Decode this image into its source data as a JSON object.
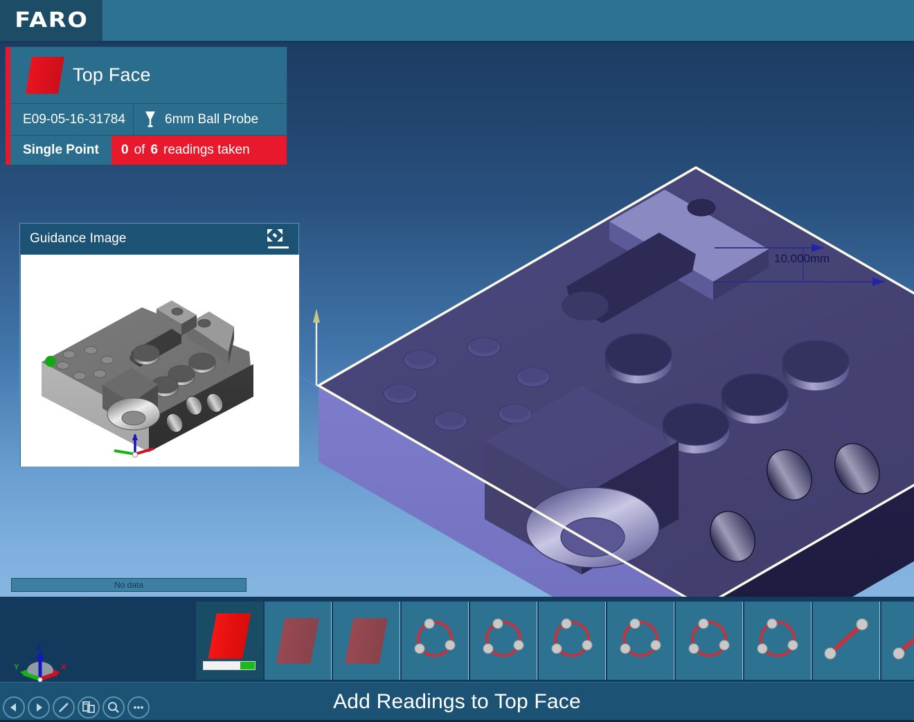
{
  "app": {
    "brand": "FARO",
    "accent_red": "#e8192c",
    "header_teal": "#2d7391",
    "panel_teal": "#2a6d8c"
  },
  "feature_panel": {
    "title": "Top Face",
    "swatch_icon": "plane-feature-icon",
    "serial": "E09-05-16-31784",
    "probe_icon": "probe-tip-icon",
    "probe": "6mm Ball Probe",
    "mode": "Single Point",
    "readings_taken": "0",
    "of_label": "of",
    "readings_total": "6",
    "readings_suffix": "readings taken"
  },
  "guidance": {
    "title": "Guidance Image",
    "expand_icon": "expand-arrows-icon"
  },
  "viewport": {
    "dimension_label": "10.000mm",
    "no_data_label": "No data",
    "gizmo": {
      "z_label": "Z",
      "y_label": "Y",
      "x_label": "X",
      "z_color": "#1a1ad0",
      "y_color": "#10b510",
      "x_color": "#d81020"
    }
  },
  "thumbnails": [
    {
      "name": "plane-feature",
      "type": "plane",
      "selected": true,
      "progress": 0
    },
    {
      "name": "plane-feature",
      "type": "plane",
      "selected": false
    },
    {
      "name": "plane-feature",
      "type": "plane",
      "selected": false
    },
    {
      "name": "circle-feature",
      "type": "circle",
      "selected": false
    },
    {
      "name": "circle-feature",
      "type": "circle",
      "selected": false
    },
    {
      "name": "circle-feature",
      "type": "circle",
      "selected": false
    },
    {
      "name": "circle-feature",
      "type": "circle",
      "selected": false
    },
    {
      "name": "circle-feature",
      "type": "circle",
      "selected": false
    },
    {
      "name": "circle-feature",
      "type": "circle",
      "selected": false
    },
    {
      "name": "line-feature",
      "type": "line",
      "selected": false
    },
    {
      "name": "line-feature",
      "type": "line",
      "selected": false
    }
  ],
  "status": {
    "message": "Add Readings to Top Face"
  },
  "nav_buttons": [
    {
      "icon": "previous-arrow-icon"
    },
    {
      "icon": "next-arrow-icon"
    },
    {
      "icon": "line-tool-icon"
    },
    {
      "icon": "layout-windows-icon"
    },
    {
      "icon": "magnifier-icon"
    },
    {
      "icon": "more-ellipsis-icon"
    }
  ]
}
